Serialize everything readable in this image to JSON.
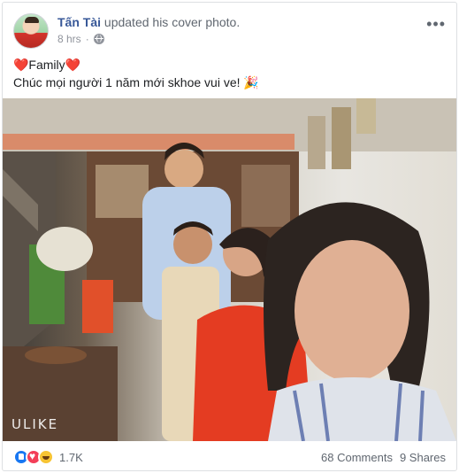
{
  "post": {
    "author": "Tấn Tài",
    "action": "updated his cover photo.",
    "time": "8 hrs",
    "dot": "·",
    "privacy_icon": "globe-icon",
    "more_icon": "more-icon",
    "caption_line1": "❤️Family❤️",
    "caption_line2": "Chúc mọi người 1 năm mới skhoe vui ve! 🎉",
    "photo_watermark": "ULIKE"
  },
  "footer": {
    "reaction_icons": [
      "like-icon",
      "love-icon",
      "haha-icon"
    ],
    "reaction_count": "1.7K",
    "comments": "68 Comments",
    "shares": "9 Shares"
  },
  "colors": {
    "author_link": "#385898",
    "secondary_text": "#606770",
    "like_blue": "#1877f2",
    "love_red": "#f33e58",
    "haha_yellow": "#f7c433"
  }
}
